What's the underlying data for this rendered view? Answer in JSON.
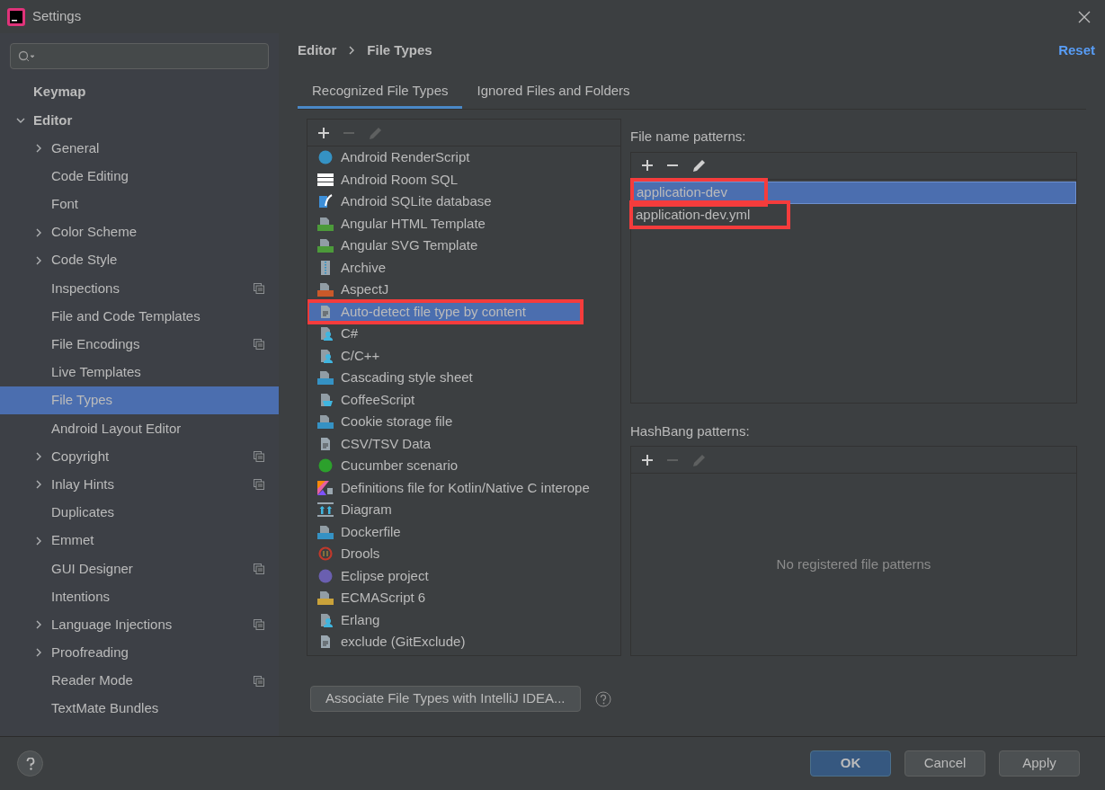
{
  "window": {
    "title": "Settings"
  },
  "sidebar": {
    "items": [
      {
        "label": "Keymap",
        "selected": false,
        "shared": false
      },
      {
        "label": "Editor",
        "expanded": true,
        "selected": false,
        "shared": false,
        "children": [
          {
            "label": "General",
            "expanded": false,
            "selected": false,
            "shared": false
          },
          {
            "label": "Code Editing",
            "selected": false,
            "shared": false
          },
          {
            "label": "Font",
            "selected": false,
            "shared": false
          },
          {
            "label": "Color Scheme",
            "expanded": false,
            "selected": false,
            "shared": false
          },
          {
            "label": "Code Style",
            "expanded": false,
            "selected": false,
            "shared": false
          },
          {
            "label": "Inspections",
            "selected": false,
            "shared": true
          },
          {
            "label": "File and Code Templates",
            "selected": false,
            "shared": false
          },
          {
            "label": "File Encodings",
            "selected": false,
            "shared": true
          },
          {
            "label": "Live Templates",
            "selected": false,
            "shared": false
          },
          {
            "label": "File Types",
            "selected": true,
            "shared": false
          },
          {
            "label": "Android Layout Editor",
            "selected": false,
            "shared": false
          },
          {
            "label": "Copyright",
            "expanded": false,
            "selected": false,
            "shared": true
          },
          {
            "label": "Inlay Hints",
            "expanded": false,
            "selected": false,
            "shared": true
          },
          {
            "label": "Duplicates",
            "selected": false,
            "shared": false
          },
          {
            "label": "Emmet",
            "expanded": false,
            "selected": false,
            "shared": false
          },
          {
            "label": "GUI Designer",
            "selected": false,
            "shared": true
          },
          {
            "label": "Intentions",
            "selected": false,
            "shared": false
          },
          {
            "label": "Language Injections",
            "expanded": false,
            "selected": false,
            "shared": true
          },
          {
            "label": "Proofreading",
            "expanded": false,
            "selected": false,
            "shared": false
          },
          {
            "label": "Reader Mode",
            "selected": false,
            "shared": true
          },
          {
            "label": "TextMate Bundles",
            "selected": false,
            "shared": false
          }
        ]
      }
    ]
  },
  "breadcrumb": [
    "Editor",
    "File Types"
  ],
  "reset": "Reset",
  "tabs": [
    {
      "label": "Recognized File Types",
      "selected": true
    },
    {
      "label": "Ignored Files and Folders",
      "selected": false
    }
  ],
  "file_types": [
    {
      "label": "Android RenderScript",
      "kind": "circle",
      "color": "#3592c4",
      "selected": false,
      "annotated": false
    },
    {
      "label": "Android Room SQL",
      "kind": "bars",
      "color": "#ffffff",
      "selected": false,
      "annotated": false
    },
    {
      "label": "Android SQLite database",
      "kind": "feather",
      "color": "#3d8fd8",
      "selected": false,
      "annotated": false
    },
    {
      "label": "Angular HTML Template",
      "kind": "badge",
      "color": "#4c9a3a",
      "selected": false,
      "annotated": false
    },
    {
      "label": "Angular SVG Template",
      "kind": "badge",
      "color": "#4c9a3a",
      "selected": false,
      "annotated": false
    },
    {
      "label": "Archive",
      "kind": "archive",
      "color": "#9aa7b0",
      "selected": false,
      "annotated": false
    },
    {
      "label": "AspectJ",
      "kind": "badge",
      "color": "#c9592a",
      "selected": false,
      "annotated": false
    },
    {
      "label": "Auto-detect file type by content",
      "kind": "doc",
      "color": "#9aa7b0",
      "selected": true,
      "annotated": true
    },
    {
      "label": "C#",
      "kind": "person",
      "color": "#40b6e0",
      "selected": false,
      "annotated": false
    },
    {
      "label": "C/C++",
      "kind": "person",
      "color": "#40b6e0",
      "selected": false,
      "annotated": false
    },
    {
      "label": "Cascading style sheet",
      "kind": "badge",
      "color": "#3592c4",
      "selected": false,
      "annotated": false
    },
    {
      "label": "CoffeeScript",
      "kind": "cup",
      "color": "#40b6e0",
      "selected": false,
      "annotated": false
    },
    {
      "label": "Cookie storage file",
      "kind": "badge",
      "color": "#3592c4",
      "selected": false,
      "annotated": false
    },
    {
      "label": "CSV/TSV Data",
      "kind": "doc",
      "color": "#9aa7b0",
      "selected": false,
      "annotated": false
    },
    {
      "label": "Cucumber scenario",
      "kind": "circle",
      "color": "#2ca02c",
      "selected": false,
      "annotated": false
    },
    {
      "label": "Definitions file for Kotlin/Native C interope",
      "kind": "kotlin",
      "color": "#e65fa2",
      "selected": false,
      "annotated": false
    },
    {
      "label": "Diagram",
      "kind": "diagram",
      "color": "#40b6e0",
      "selected": false,
      "annotated": false
    },
    {
      "label": "Dockerfile",
      "kind": "badge",
      "color": "#3592c4",
      "selected": false,
      "annotated": false
    },
    {
      "label": "Drools",
      "kind": "ring",
      "color": "#c0392b",
      "selected": false,
      "annotated": false
    },
    {
      "label": "Eclipse project",
      "kind": "circle",
      "color": "#6a5fb0",
      "selected": false,
      "annotated": false
    },
    {
      "label": "ECMAScript 6",
      "kind": "badge",
      "color": "#c9a23a",
      "selected": false,
      "annotated": false
    },
    {
      "label": "Erlang",
      "kind": "person",
      "color": "#40b6e0",
      "selected": false,
      "annotated": false
    },
    {
      "label": "exclude (GitExclude)",
      "kind": "doc",
      "color": "#9aa7b0",
      "selected": false,
      "annotated": false
    }
  ],
  "file_name_patterns": {
    "label": "File name patterns:",
    "items": [
      {
        "label": "application-dev",
        "selected": true,
        "annotated": true
      },
      {
        "label": "application-dev.yml",
        "selected": false,
        "annotated": true
      }
    ]
  },
  "hashbang_patterns": {
    "label": "HashBang patterns:",
    "empty_text": "No registered file patterns"
  },
  "associate_button": "Associate File Types with IntelliJ IDEA...",
  "buttons": [
    {
      "label": "OK",
      "kind": "default"
    },
    {
      "label": "Cancel",
      "kind": "normal"
    },
    {
      "label": "Apply",
      "kind": "normal"
    }
  ]
}
